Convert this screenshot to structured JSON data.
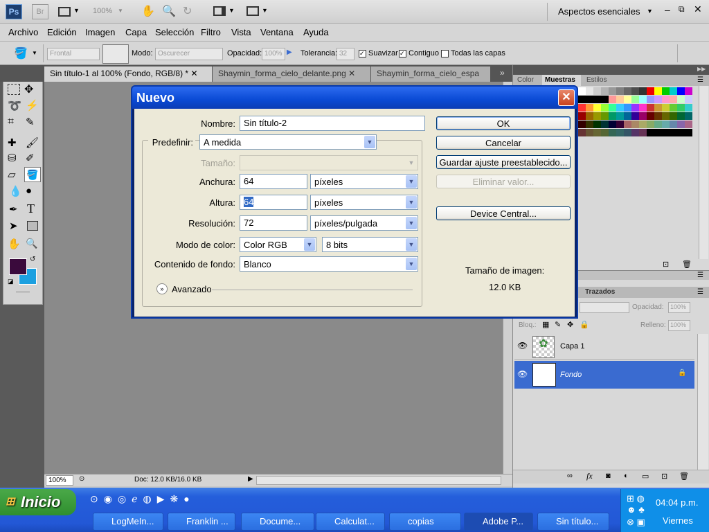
{
  "app": {
    "logo": "Ps",
    "bridge": "Br",
    "zoom": "100%",
    "workspace": "Aspectos esenciales"
  },
  "menu": [
    "Archivo",
    "Edición",
    "Imagen",
    "Capa",
    "Selección",
    "Filtro",
    "Vista",
    "Ventana",
    "Ayuda"
  ],
  "options": {
    "source": "Frontal",
    "mode_label": "Modo:",
    "mode_value": "Oscurecer",
    "opacity_label": "Opacidad:",
    "opacity_value": "100%",
    "tolerance_label": "Tolerancia:",
    "tolerance_value": "32",
    "smooth_label": "Suavizar",
    "contiguous_label": "Contiguo",
    "all_layers_label": "Todas las capas"
  },
  "tabs": [
    "Sin título-1 al 100% (Fondo, RGB/8) *",
    "Shaymin_forma_cielo_delante.png",
    "Shaymin_forma_cielo_espa"
  ],
  "status": {
    "zoom": "100%",
    "doc": "Doc: 12.0 KB/16.0 KB"
  },
  "panels": {
    "color_tab": "Color",
    "swatches_tab": "Muestras",
    "styles_tab": "Estilos",
    "paths_tab": "Trazados",
    "opacity_label": "Opacidad:",
    "opacity_value": "100%",
    "lock_label": "Bloq.:",
    "fill_label": "Relleno:",
    "fill_value": "100%",
    "layers": [
      "Capa 1",
      "Fondo"
    ]
  },
  "dialog": {
    "title": "Nuevo",
    "name_label": "Nombre:",
    "name_value": "Sin título-2",
    "preset_label": "Predefinir:",
    "preset_value": "A medida",
    "size_label": "Tamaño:",
    "width_label": "Anchura:",
    "width_value": "64",
    "width_unit": "píxeles",
    "height_label": "Altura:",
    "height_value": "64",
    "height_unit": "píxeles",
    "resolution_label": "Resolución:",
    "resolution_value": "72",
    "resolution_unit": "píxeles/pulgada",
    "color_mode_label": "Modo de color:",
    "color_mode_value": "Color RGB",
    "bits_value": "8 bits",
    "background_label": "Contenido de fondo:",
    "background_value": "Blanco",
    "advanced_label": "Avanzado",
    "ok": "OK",
    "cancel": "Cancelar",
    "save_preset": "Guardar ajuste preestablecido...",
    "delete_preset": "Eliminar valor...",
    "device_central": "Device Central...",
    "image_size_label": "Tamaño de imagen:",
    "image_size_value": "12.0 KB"
  },
  "taskbar": {
    "start": "Inicio",
    "items": [
      "LogMeIn...",
      "Franklin ...",
      "Docume...",
      "Calculat...",
      "copias",
      "Adobe P...",
      "Sin título..."
    ],
    "clock": "04:04 p.m.",
    "day": "Viernes"
  },
  "colors": {
    "foreground": "#3a0a3c",
    "background": "#1ca0e0",
    "selection": "#3a6bd0"
  }
}
